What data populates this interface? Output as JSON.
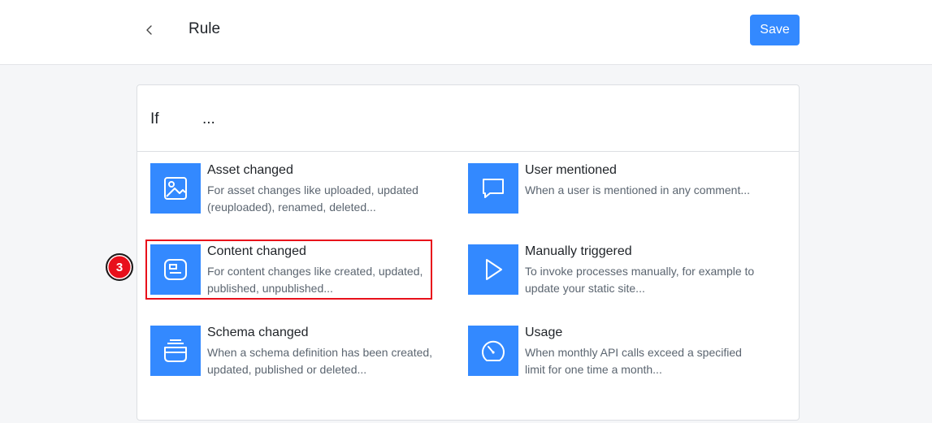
{
  "header": {
    "title": "Rule",
    "save_label": "Save"
  },
  "card": {
    "if_label": "If",
    "if_placeholder": "..."
  },
  "triggers": [
    {
      "name": "Asset changed",
      "description": "For asset changes like uploaded, updated (reuploaded), renamed, deleted...",
      "icon": "image-icon"
    },
    {
      "name": "User mentioned",
      "description": "When a user is mentioned in any comment...",
      "icon": "comment-icon"
    },
    {
      "name": "Content changed",
      "description": "For content changes like created, updated, published, unpublished...",
      "icon": "content-icon"
    },
    {
      "name": "Manually triggered",
      "description": "To invoke processes manually, for example to update your static site...",
      "icon": "play-icon"
    },
    {
      "name": "Schema changed",
      "description": "When a schema definition has been created, updated, published or deleted...",
      "icon": "schema-icon"
    },
    {
      "name": "Usage",
      "description": "When monthly API calls exceed a specified limit for one time a month...",
      "icon": "dashboard-icon"
    }
  ],
  "annotation": {
    "step": "3",
    "color": "#e8101b"
  },
  "colors": {
    "accent": "#3389ff"
  }
}
